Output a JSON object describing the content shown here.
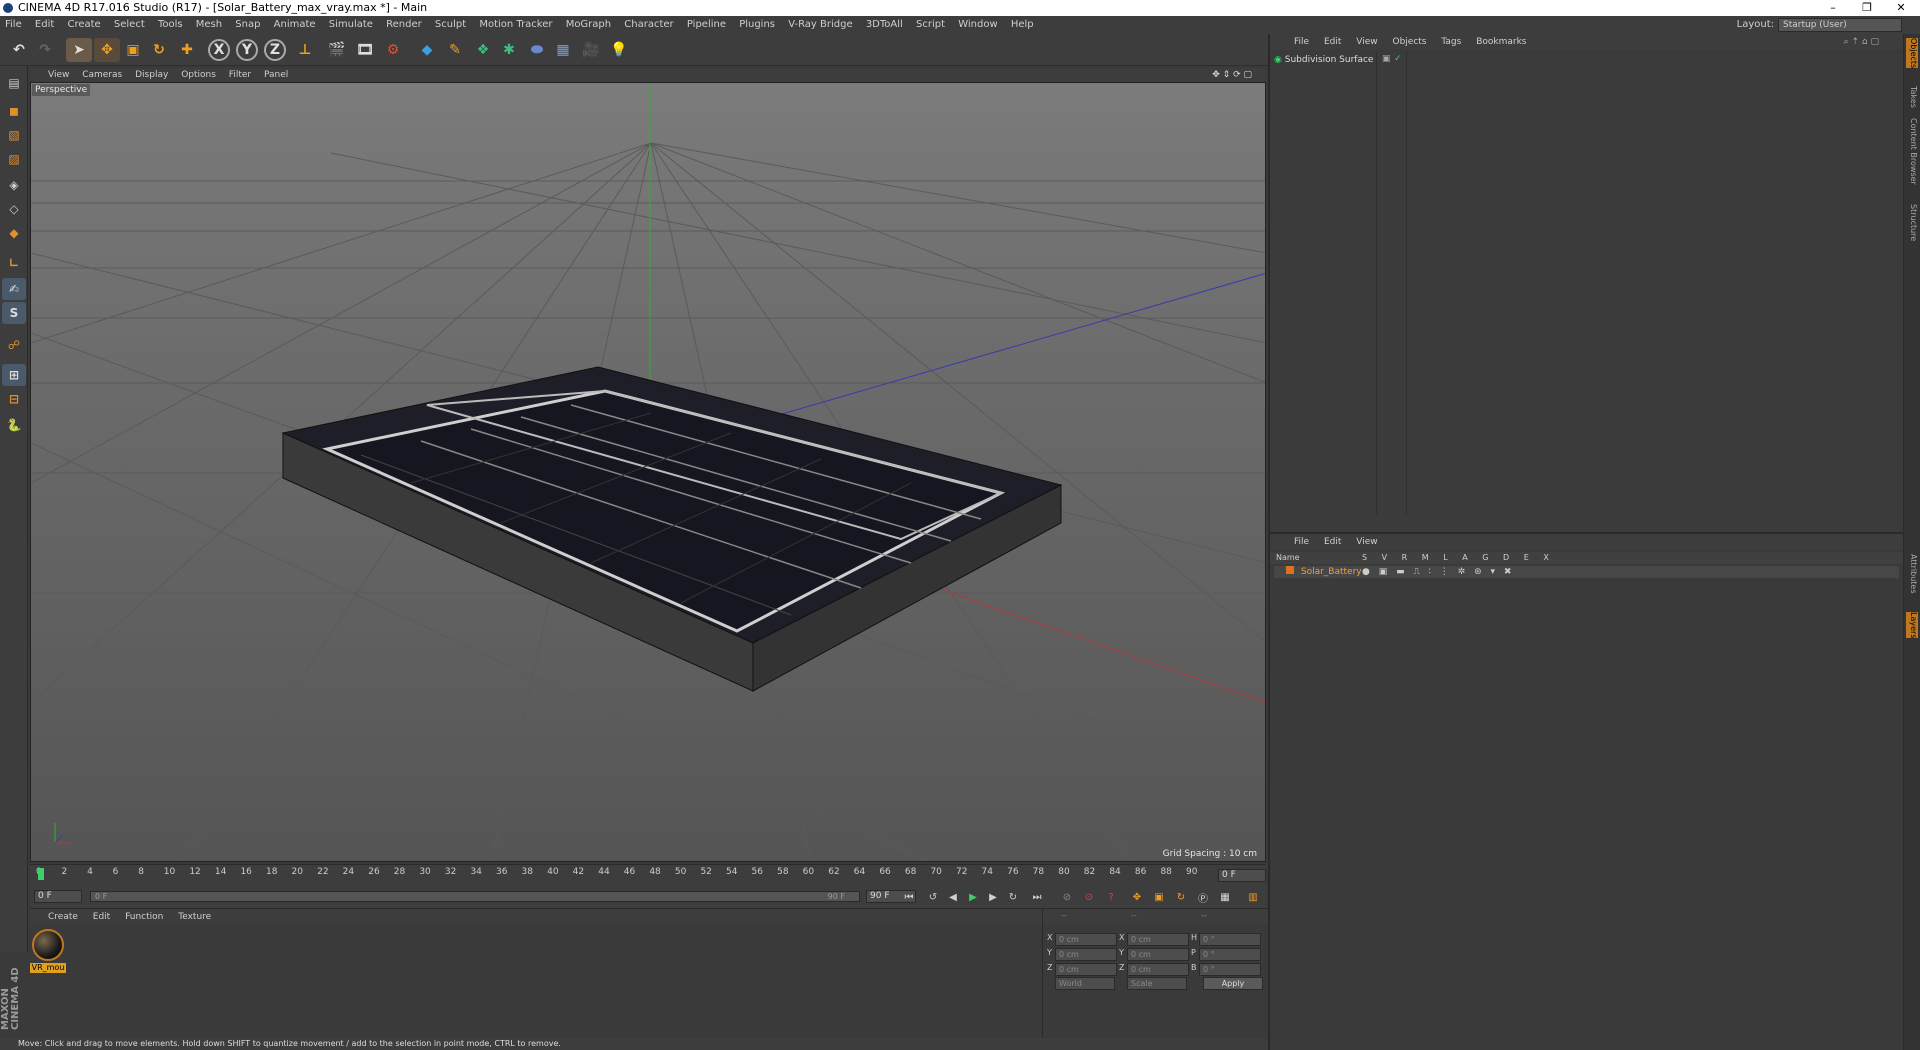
{
  "window": {
    "title": "CINEMA 4D R17.016 Studio (R17) - [Solar_Battery_max_vray.max *] - Main",
    "controls": [
      "–",
      "❐",
      "✕"
    ]
  },
  "menubar": [
    "File",
    "Edit",
    "Create",
    "Select",
    "Tools",
    "Mesh",
    "Snap",
    "Animate",
    "Simulate",
    "Render",
    "Sculpt",
    "Motion Tracker",
    "MoGraph",
    "Character",
    "Pipeline",
    "Plugins",
    "V-Ray Bridge",
    "3DToAll",
    "Script",
    "Window",
    "Help"
  ],
  "layout": {
    "label": "Layout:",
    "value": "Startup (User)"
  },
  "toolbar": {
    "axis_x": "X",
    "axis_y": "Y",
    "axis_z": "Z"
  },
  "viewport": {
    "menu": [
      "View",
      "Cameras",
      "Display",
      "Options",
      "Filter",
      "Panel"
    ],
    "label": "Perspective",
    "grid_spacing": "Grid Spacing : 10 cm"
  },
  "timeline": {
    "ticks": [
      "0",
      "2",
      "4",
      "6",
      "8",
      "10",
      "12",
      "14",
      "16",
      "18",
      "20",
      "22",
      "24",
      "26",
      "28",
      "30",
      "32",
      "34",
      "36",
      "38",
      "40",
      "42",
      "44",
      "46",
      "48",
      "50",
      "52",
      "54",
      "56",
      "58",
      "60",
      "62",
      "64",
      "66",
      "68",
      "70",
      "72",
      "74",
      "76",
      "78",
      "80",
      "82",
      "84",
      "86",
      "88",
      "90"
    ],
    "current_frame": "0 F",
    "start": "0 F",
    "range_start": "0 F",
    "range_end": "90 F",
    "end": "90 F"
  },
  "material_manager": {
    "menu": [
      "Create",
      "Edit",
      "Function",
      "Texture"
    ],
    "material_name": "VR_mou"
  },
  "coordinates": {
    "header": [
      "--",
      "--",
      "--"
    ],
    "rows": [
      {
        "a": "X",
        "a_val": "0 cm",
        "b": "X",
        "b_val": "0 cm",
        "c": "H",
        "c_val": "0 °"
      },
      {
        "a": "Y",
        "a_val": "0 cm",
        "b": "Y",
        "b_val": "0 cm",
        "c": "P",
        "c_val": "0 °"
      },
      {
        "a": "Z",
        "a_val": "0 cm",
        "b": "Z",
        "b_val": "0 cm",
        "c": "B",
        "c_val": "0 °"
      }
    ],
    "world": "World",
    "scale": "Scale",
    "apply": "Apply"
  },
  "object_manager": {
    "menu": [
      "File",
      "Edit",
      "View",
      "Objects",
      "Tags",
      "Bookmarks"
    ],
    "object": "Subdivision Surface"
  },
  "layer_manager": {
    "menu": [
      "File",
      "Edit",
      "View"
    ],
    "col_name": "Name",
    "cols": [
      "S",
      "V",
      "R",
      "M",
      "L",
      "A",
      "G",
      "D",
      "E",
      "X"
    ],
    "layer": "Solar_Battery",
    "layer_color": "#e07020"
  },
  "side_tabs": [
    "Objects",
    "Takes",
    "Content Browser",
    "Structure",
    "Attributes",
    "Layers"
  ],
  "status": "Move: Click and drag to move elements. Hold down SHIFT to quantize movement / add to the selection in point mode, CTRL to remove.",
  "maxon": "MAXON CINEMA 4D"
}
